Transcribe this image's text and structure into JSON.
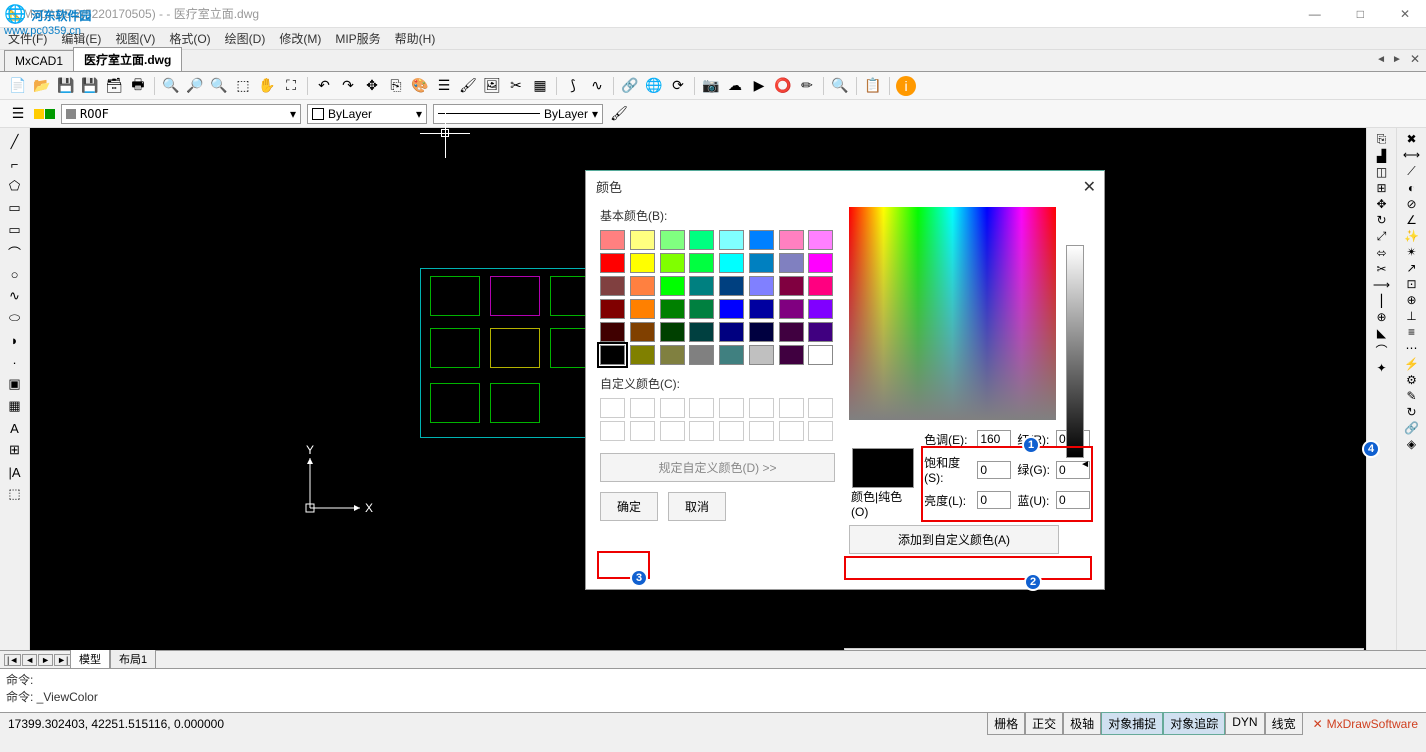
{
  "window": {
    "title": "MxCAD5.2(5220170505) - - 医疗室立面.dwg",
    "min": "—",
    "max": "□",
    "close": "✕"
  },
  "logo": {
    "text": "河东软件园",
    "url": "www.pc0359.cn"
  },
  "menu": [
    "文件(F)",
    "编辑(E)",
    "视图(V)",
    "格式(O)",
    "绘图(D)",
    "修改(M)",
    "MIP服务",
    "帮助(H)"
  ],
  "tabs": {
    "items": [
      "MxCAD1",
      "医疗室立面.dwg"
    ],
    "active": 1
  },
  "propbar": {
    "layer": "ROOF",
    "linetype": "ByLayer",
    "lineweight": "ByLayer"
  },
  "layout": {
    "tabs": [
      "模型",
      "布局1"
    ],
    "active": 0
  },
  "cmd": {
    "l1": "命令:",
    "l2": "命令: _ViewColor"
  },
  "status": {
    "coords": "17399.302403,  42251.515116,  0.000000",
    "btns": [
      "栅格",
      "正交",
      "极轴",
      "对象捕捉",
      "对象追踪",
      "DYN",
      "线宽"
    ],
    "active": [
      3,
      4
    ],
    "brand": "MxDrawSoftware"
  },
  "dialog": {
    "title": "颜色",
    "basic_label": "基本颜色(B):",
    "custom_label": "自定义颜色(C):",
    "define_btn": "规定自定义颜色(D) >>",
    "ok": "确定",
    "cancel": "取消",
    "preview_label": "颜色|纯色(O)",
    "hue_l": "色调(E):",
    "sat_l": "饱和度(S):",
    "lum_l": "亮度(L):",
    "red_l": "红(R):",
    "green_l": "绿(G):",
    "blue_l": "蓝(U):",
    "hue": "160",
    "sat": "0",
    "lum": "0",
    "red": "0",
    "green": "0",
    "blue": "0",
    "add_custom": "添加到自定义颜色(A)",
    "basic_colors": [
      "#ff8080",
      "#ffff80",
      "#80ff80",
      "#00ff80",
      "#80ffff",
      "#0080ff",
      "#ff80c0",
      "#ff80ff",
      "#ff0000",
      "#ffff00",
      "#80ff00",
      "#00ff40",
      "#00ffff",
      "#0080c0",
      "#8080c0",
      "#ff00ff",
      "#804040",
      "#ff8040",
      "#00ff00",
      "#008080",
      "#004080",
      "#8080ff",
      "#800040",
      "#ff0080",
      "#800000",
      "#ff8000",
      "#008000",
      "#008040",
      "#0000ff",
      "#0000a0",
      "#800080",
      "#8000ff",
      "#400000",
      "#804000",
      "#004000",
      "#004040",
      "#000080",
      "#000040",
      "#400040",
      "#400080",
      "#000000",
      "#808000",
      "#808040",
      "#808080",
      "#408080",
      "#c0c0c0",
      "#400040",
      "#ffffff"
    ]
  },
  "badges": {
    "b1": "1",
    "b2": "2",
    "b3": "3",
    "b4": "4"
  },
  "ucs": {
    "x": "X",
    "y": "Y"
  }
}
